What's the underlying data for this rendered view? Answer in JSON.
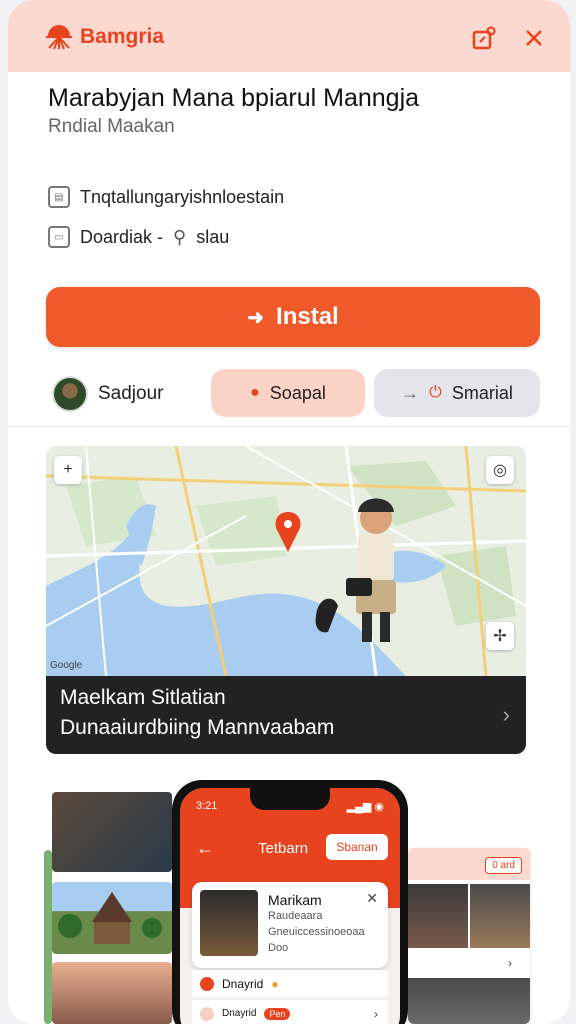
{
  "header": {
    "brand": "Bamgria",
    "brand_color": "#e8431f",
    "brand_icon": "sun-logo-icon",
    "share_icon": "share-icon",
    "close_icon": "close-icon"
  },
  "app": {
    "title": "Marabyjan Mana bpiarul Manngja",
    "subtitle": "Rndial Maakan",
    "info_1": "Tnqtallungaryishnloestain",
    "info_2_prefix": "Doardiak -",
    "info_2_suffix": "slau"
  },
  "install": {
    "label": "Instal",
    "icon": "arrow-right-icon",
    "color": "#f05a2a"
  },
  "actions": {
    "user_label": "Sadjour",
    "chip_1": "Soapal",
    "chip_2": "Smarial"
  },
  "map": {
    "caption_1": "Maelkam Sitlatian",
    "caption_2": "Dunaaiurdbiing Mannvaabam",
    "zoom_label": "+",
    "credit": "Google"
  },
  "phone": {
    "time": "3:21",
    "screen_title": "Tetbarn",
    "screen_button": "Sbanan",
    "card_name": "Marikam",
    "card_line_1": "Raudeaara",
    "card_line_2": "Gneuiccessinoeoaa",
    "card_line_3": "Doo",
    "row_1": "Dnayrid",
    "row_2": "Dnayrid",
    "row_2_pill": "Pen"
  },
  "side_panel": {
    "badge": "0 ard"
  }
}
